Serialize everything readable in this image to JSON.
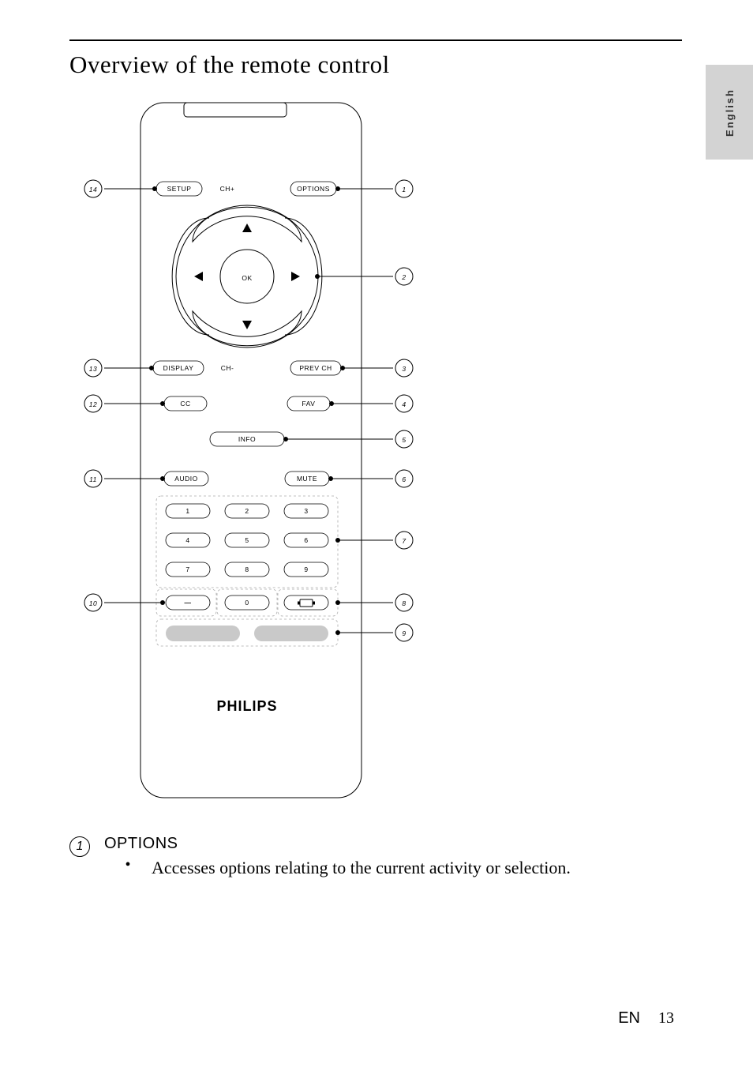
{
  "heading": "Overview of the remote control",
  "side_tab": "English",
  "remote": {
    "brand": "PHILIPS",
    "row1": {
      "left": "SETUP",
      "center": "CH+",
      "right": "OPTIONS"
    },
    "dpad": {
      "center": "OK"
    },
    "row2": {
      "left": "DISPLAY",
      "center": "CH-",
      "right": "PREV CH"
    },
    "row3": {
      "left": "CC",
      "right": "FAV"
    },
    "row4": {
      "center": "INFO"
    },
    "row5": {
      "left": "AUDIO",
      "right": "MUTE"
    },
    "numpad": [
      "1",
      "2",
      "3",
      "4",
      "5",
      "6",
      "7",
      "8",
      "9",
      "0"
    ],
    "dash_key": "—"
  },
  "callouts": {
    "right": [
      "1",
      "2",
      "3",
      "4",
      "5",
      "6",
      "7",
      "8",
      "9"
    ],
    "left": [
      "14",
      "13",
      "12",
      "11",
      "10"
    ]
  },
  "description": {
    "num": "1",
    "label": "OPTIONS",
    "bullet": "Accesses options relating to the current activity or selection."
  },
  "footer": {
    "lang": "EN",
    "page": "13"
  }
}
